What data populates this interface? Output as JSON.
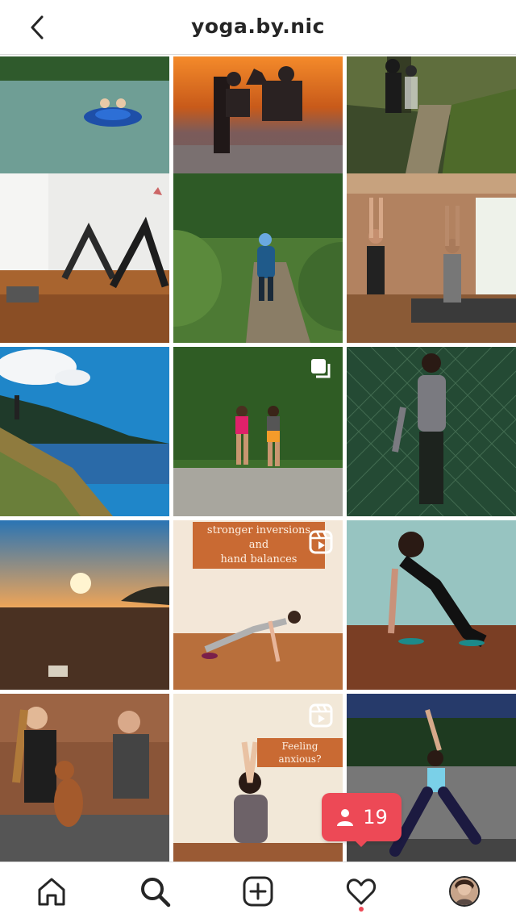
{
  "header": {
    "title": "yoga.by.nic"
  },
  "posts": [
    {
      "label": "Kids on inflatable tube on lake"
    },
    {
      "label": "Sunset on beach with chairs"
    },
    {
      "label": "Trail run in forest"
    },
    {
      "label": "Downward dog in studio"
    },
    {
      "label": "Child walking on forest trail"
    },
    {
      "label": "Upward salute at home"
    },
    {
      "label": "Coastal hillside"
    },
    {
      "label": "Two women running on trail"
    },
    {
      "label": "Stretch by chain link fence"
    },
    {
      "label": "Ocean sunset"
    },
    {
      "label": "Reel: stronger inversions",
      "overlay": [
        "stronger inversions and",
        "hand balances"
      ]
    },
    {
      "label": "Low lunge with sliders"
    },
    {
      "label": "Friends with dog on steps"
    },
    {
      "label": "Reel: feeling anxious",
      "overlay": [
        "Feeling anxious?"
      ]
    },
    {
      "label": "Warrior pose outdoors"
    }
  ],
  "notification": {
    "count": "19"
  },
  "colors": {
    "accent": "#ed4956",
    "text": "#262626",
    "overlay_bg": "#c96a33"
  },
  "tabs": [
    "home-icon",
    "search-icon",
    "new-post-icon",
    "activity-heart-icon",
    "profile-avatar"
  ]
}
